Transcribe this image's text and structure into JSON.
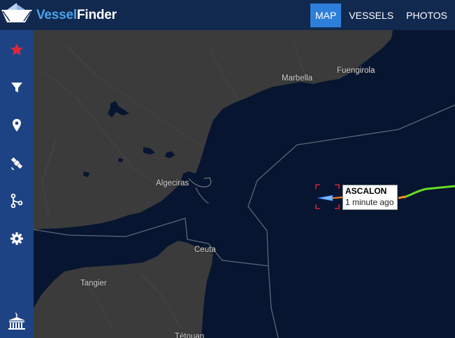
{
  "brand": {
    "part1": "Vessel",
    "part2": "Finder"
  },
  "nav": {
    "map": "MAP",
    "vessels": "VESSELS",
    "photos": "PHOTOS"
  },
  "map_labels": {
    "fuengirola": "Fuengirola",
    "marbella": "Marbella",
    "algeciras": "Algeciras",
    "ceuta": "Ceuta",
    "tangier": "Tangier",
    "tetouan": "Tétouan"
  },
  "vessel": {
    "name": "ASCALON",
    "updated": "1 minute ago"
  },
  "colors": {
    "topbar": "#11284f",
    "sidebar": "#1e4384",
    "nav_active": "#2e7fd9",
    "sea": "#071530",
    "land": "#3b3b3b",
    "track": "#66dd22",
    "favorite": "#e0263a"
  },
  "icons": [
    "logo-ship-icon",
    "star-icon",
    "filter-icon",
    "location-pin-icon",
    "satellite-icon",
    "route-icon",
    "gear-icon",
    "port-icon"
  ]
}
